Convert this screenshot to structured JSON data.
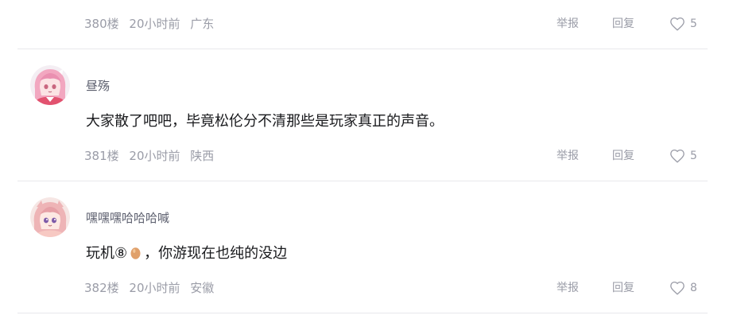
{
  "labels": {
    "report": "举报",
    "reply": "回复"
  },
  "comments": [
    {
      "floor": "380楼",
      "time": "20小时前",
      "location": "广东",
      "likes": "5"
    },
    {
      "username": "昼殇",
      "content": "大家散了吧吧，毕竟松伦分不清那些是玩家真正的声音。",
      "floor": "381楼",
      "time": "20小时前",
      "location": "陕西",
      "likes": "5",
      "avatar_icon": "anime-avatar-icon"
    },
    {
      "username": "嘿嘿嘿哈哈哈喊",
      "content_before_emoji": "玩机⑧",
      "content_emoji": "egg-emoji-icon",
      "content_after_emoji": "，你游现在也纯的没边",
      "floor": "382楼",
      "time": "20小时前",
      "location": "安徽",
      "likes": "8",
      "avatar_icon": "anime-avatar-icon"
    }
  ],
  "colors": {
    "meta_text": "#9a9ca7",
    "username": "#5c5f6e",
    "content": "#18191c",
    "divider": "#e8e8ec"
  }
}
